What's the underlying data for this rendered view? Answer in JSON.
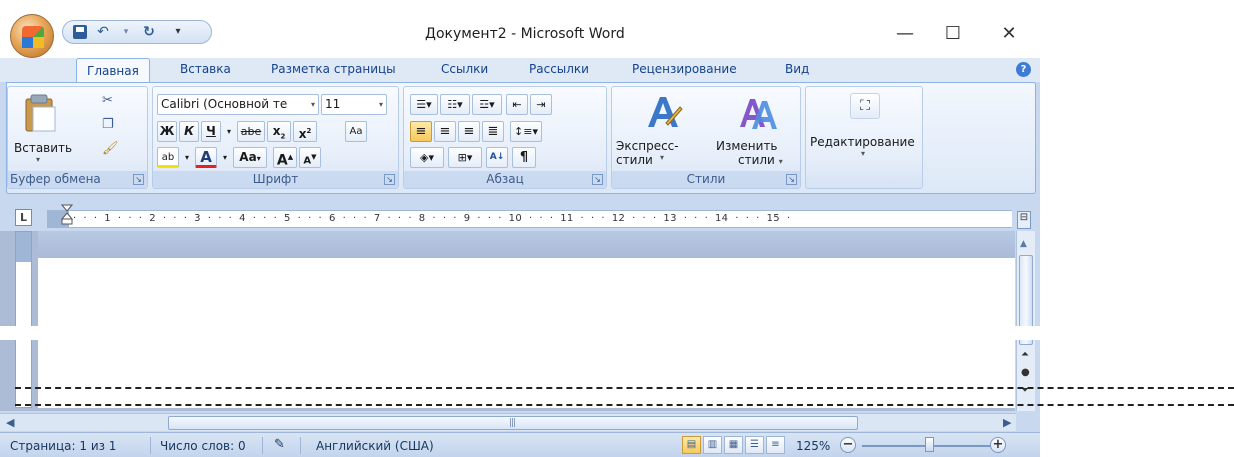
{
  "window": {
    "title": "Документ2 - Microsoft Word"
  },
  "qat": {
    "undo_glyph": "↶",
    "redo_glyph": "↻",
    "more_glyph": "▾"
  },
  "controls": {
    "minimize": "—",
    "maximize": "☐",
    "close": "✕"
  },
  "tabs": [
    {
      "label": "Главная",
      "active": true
    },
    {
      "label": "Вставка"
    },
    {
      "label": "Разметка страницы"
    },
    {
      "label": "Ссылки"
    },
    {
      "label": "Рассылки"
    },
    {
      "label": "Рецензирование"
    },
    {
      "label": "Вид"
    }
  ],
  "help": "?",
  "clipboard": {
    "paste_label": "Вставить",
    "group_label": "Буфер обмена"
  },
  "font": {
    "family": "Calibri (Основной те",
    "size": "11",
    "bold": "Ж",
    "italic": "К",
    "underline": "Ч",
    "strike": "abe",
    "subscript": "x",
    "superscript": "x",
    "case": "Aa",
    "grow": "A",
    "shrink": "A",
    "color_a": "A",
    "group_label": "Шрифт"
  },
  "paragraph": {
    "pilcrow": "¶",
    "group_label": "Абзац"
  },
  "styles": {
    "express_label": "Экспресс-стили",
    "change_label_1": "Изменить",
    "change_label_2": "стили",
    "group_label": "Стили"
  },
  "editing": {
    "label": "Редактирование"
  },
  "ruler": {
    "corner": "L",
    "numbers": "·  ·  ·  1  ·  ·  ·  2  ·  ·  ·  3  ·  ·  ·  4  ·  ·  ·  5  ·  ·  ·  6  ·  ·  ·  7  ·  ·  ·  8  ·  ·  ·  9  ·  ·  ·  10  ·  ·  ·  11  ·  ·  ·  12  ·  ·  ·  13  ·  ·  ·  14  ·  ·  ·  15  ·"
  },
  "status": {
    "page": "Страница: 1 из 1",
    "words": "Число слов: 0",
    "language": "Английский (США)",
    "zoom": "125%"
  },
  "colors": {
    "accent": "#15428b",
    "ribbon_bg": "#dce8f7",
    "frame": "#c7d8ef"
  }
}
